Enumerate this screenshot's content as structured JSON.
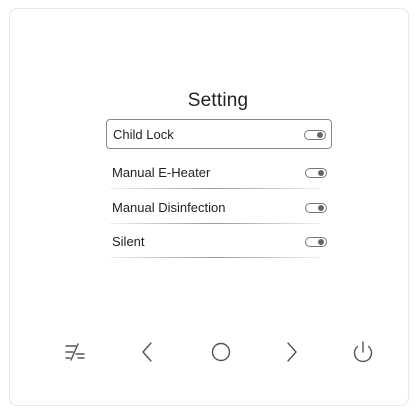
{
  "screen": {
    "title": "Setting",
    "items": [
      {
        "label": "Child Lock",
        "selected": true,
        "toggle_on": true
      },
      {
        "label": "Manual E-Heater",
        "selected": false,
        "toggle_on": true
      },
      {
        "label": "Manual Disinfection",
        "selected": false,
        "toggle_on": true
      },
      {
        "label": "Silent",
        "selected": false,
        "toggle_on": true
      }
    ]
  },
  "buttons": [
    {
      "icon": "mode-icon"
    },
    {
      "icon": "chevron-left-icon"
    },
    {
      "icon": "circle-icon"
    },
    {
      "icon": "chevron-right-icon"
    },
    {
      "icon": "power-icon"
    }
  ],
  "colors": {
    "panel_border": "#e6e6e6",
    "icon_stroke": "#555555",
    "text": "#222222"
  }
}
